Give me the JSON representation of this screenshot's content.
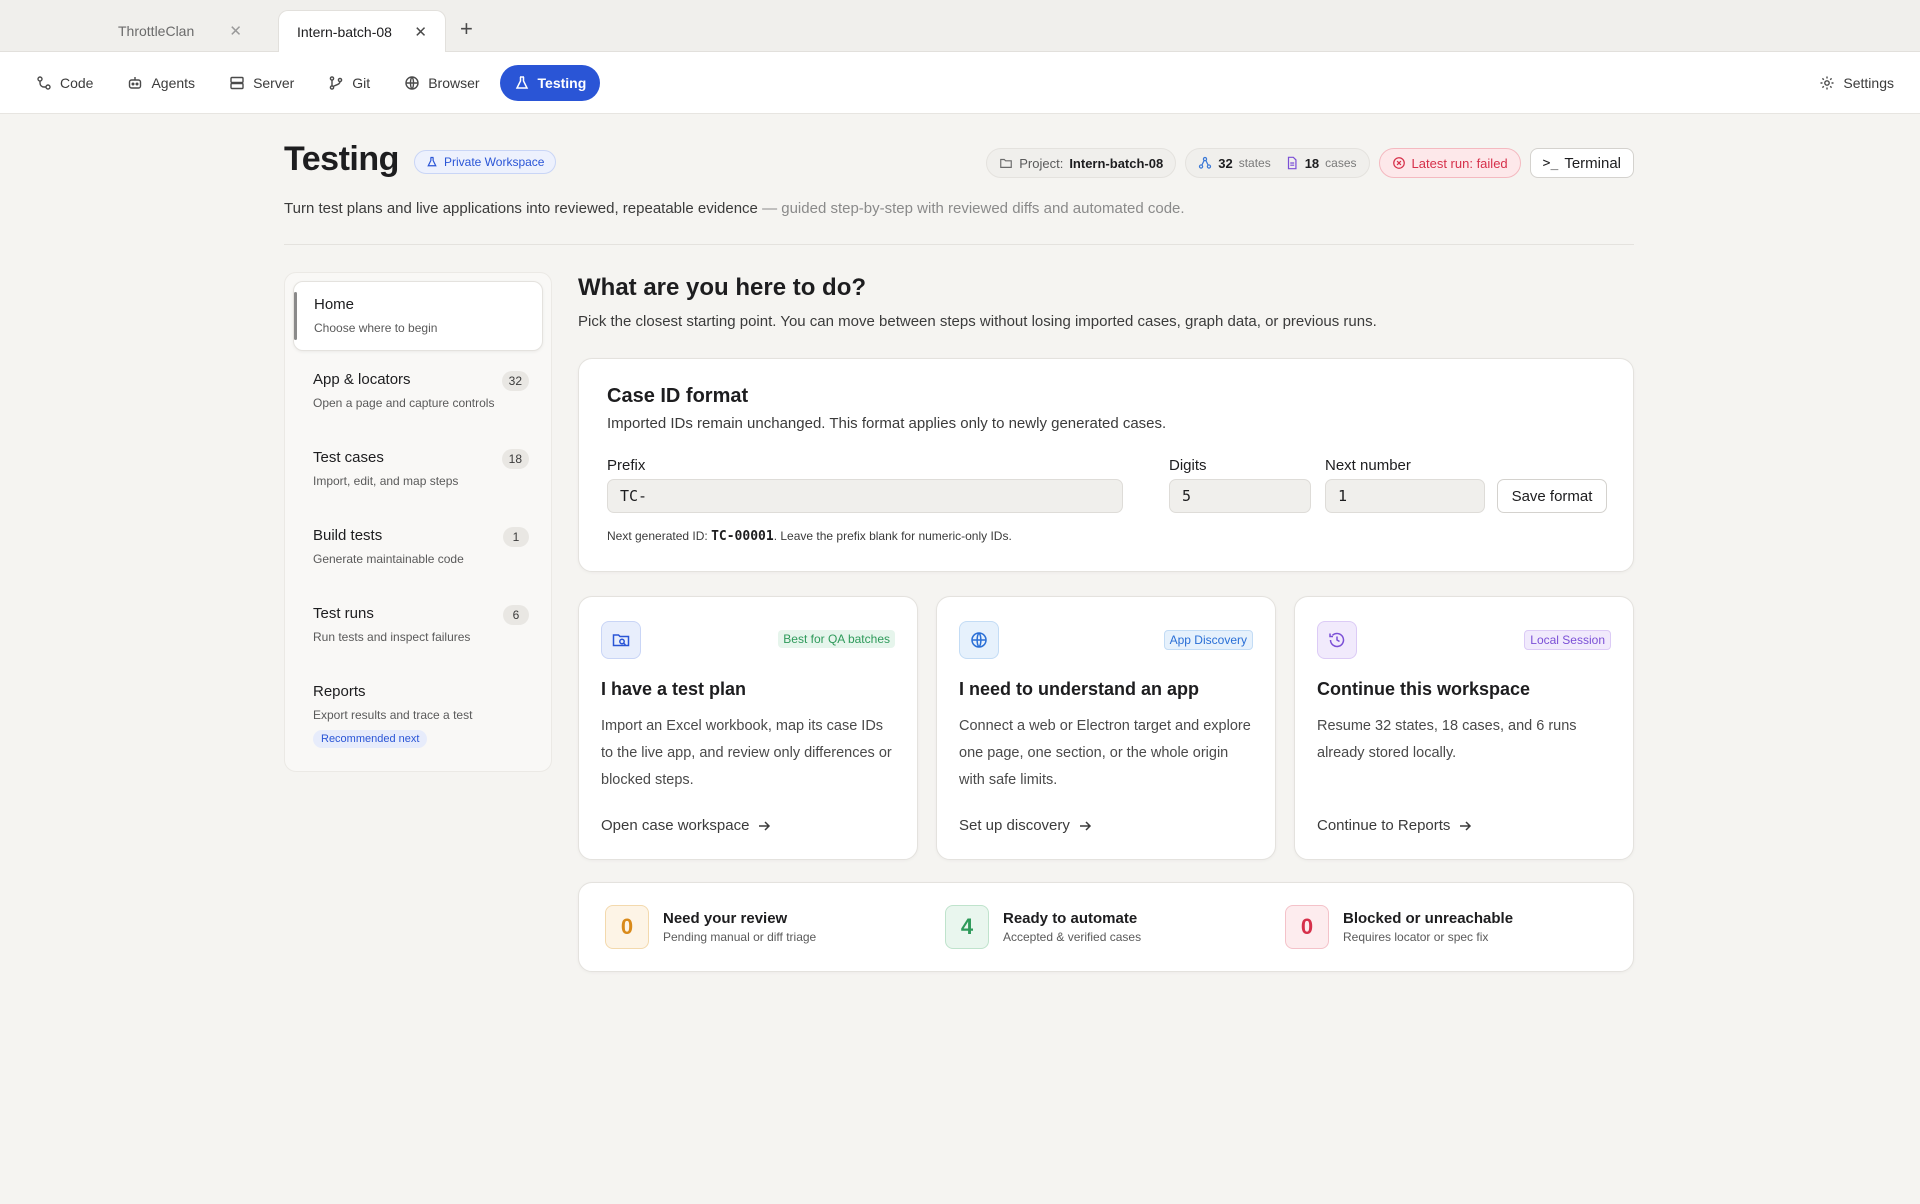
{
  "tabs": [
    {
      "label": "ThrottleClan"
    },
    {
      "label": "Intern-batch-08"
    }
  ],
  "nav": {
    "items": [
      {
        "label": "Code",
        "icon": "code-icon"
      },
      {
        "label": "Agents",
        "icon": "robot-icon"
      },
      {
        "label": "Server",
        "icon": "server-icon"
      },
      {
        "label": "Git",
        "icon": "git-branch-icon"
      },
      {
        "label": "Browser",
        "icon": "globe-icon"
      },
      {
        "label": "Testing",
        "icon": "flask-icon"
      }
    ],
    "active": "Testing",
    "settings_label": "Settings"
  },
  "header": {
    "title": "Testing",
    "workspace_badge": "Private Workspace",
    "project_label": "Project:",
    "project_name": "Intern-batch-08",
    "states_count": "32",
    "states_label": "states",
    "cases_count": "18",
    "cases_label": "cases",
    "latest_run": "Latest run: failed",
    "terminal_label": "Terminal",
    "subtitle": "Turn test plans and live applications into reviewed, repeatable evidence",
    "subtitle_soft": " — guided step-by-step with reviewed diffs and automated code."
  },
  "sidebar": {
    "items": [
      {
        "title": "Home",
        "desc": "Choose where to begin",
        "count": ""
      },
      {
        "title": "App & locators",
        "desc": "Open a page and capture controls",
        "count": "32"
      },
      {
        "title": "Test cases",
        "desc": "Import, edit, and map steps",
        "count": "18"
      },
      {
        "title": "Build tests",
        "desc": "Generate maintainable code",
        "count": "1"
      },
      {
        "title": "Test runs",
        "desc": "Run tests and inspect failures",
        "count": "6"
      },
      {
        "title": "Reports",
        "desc": "Export results and trace a test",
        "count": "",
        "badge": "Recommended next"
      }
    ]
  },
  "main": {
    "heading": "What are you here to do?",
    "subheading": "Pick the closest starting point. You can move between steps without losing imported cases, graph data, or previous runs."
  },
  "case_format": {
    "title": "Case ID format",
    "subtitle": "Imported IDs remain unchanged. This format applies only to newly generated cases.",
    "prefix_label": "Prefix",
    "prefix_value": "TC-",
    "digits_label": "Digits",
    "digits_value": "5",
    "next_label": "Next number",
    "next_value": "1",
    "save_label": "Save format",
    "note_pre": "Next generated ID: ",
    "note_id": "TC-00001",
    "note_post": ". Leave the prefix blank for numeric-only IDs."
  },
  "options": [
    {
      "icon": "folder-search-icon",
      "tag": "Best for QA batches",
      "title": "I have a test plan",
      "body": "Import an Excel workbook, map its case IDs to the live app, and review only differences or blocked steps.",
      "link": "Open case workspace"
    },
    {
      "icon": "globe-icon",
      "tag": "App Discovery",
      "title": "I need to understand an app",
      "body": "Connect a web or Electron target and explore one page, one section, or the whole origin with safe limits.",
      "link": "Set up discovery"
    },
    {
      "icon": "history-icon",
      "tag": "Local Session",
      "title": "Continue this workspace",
      "body": "Resume 32 states, 18 cases, and 6 runs already stored locally.",
      "link": "Continue to Reports"
    }
  ],
  "stats": [
    {
      "value": "0",
      "title": "Need your review",
      "desc": "Pending manual or diff triage",
      "color": "#d98a1a"
    },
    {
      "value": "4",
      "title": "Ready to automate",
      "desc": "Accepted & verified cases",
      "color": "#2e9a5a"
    },
    {
      "value": "0",
      "title": "Blocked or unreachable",
      "desc": "Requires locator or spec fix",
      "color": "#d6304a"
    }
  ],
  "colors": {
    "accent": "#2a55d6",
    "background": "#f5f4f1",
    "danger": "#d6304a"
  }
}
